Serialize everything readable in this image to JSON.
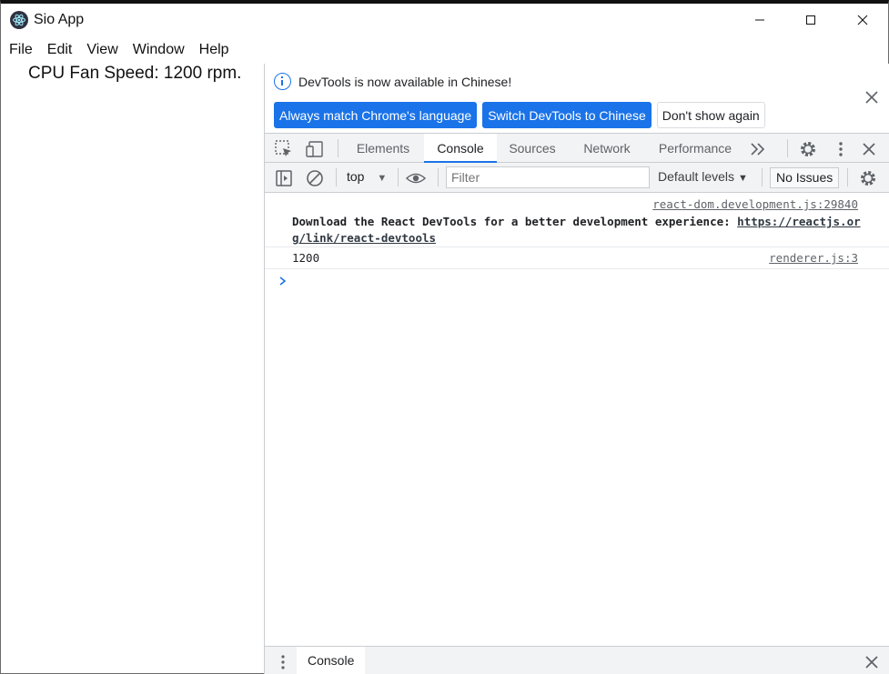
{
  "window": {
    "title": "Sio App",
    "minimize_icon": "minimize-icon",
    "maximize_icon": "maximize-icon",
    "close_icon": "close-icon"
  },
  "menu": [
    "File",
    "Edit",
    "View",
    "Window",
    "Help"
  ],
  "app": {
    "fan_speed_text": "CPU Fan Speed: 1200 rpm."
  },
  "devtools": {
    "infobar": {
      "message": "DevTools is now available in Chinese!",
      "buttons": {
        "always_match": "Always match Chrome's language",
        "switch": "Switch DevTools to Chinese",
        "dont_show": "Don't show again"
      }
    },
    "tabs": [
      "Elements",
      "Console",
      "Sources",
      "Network",
      "Performance"
    ],
    "active_tab": "Console",
    "filterbar": {
      "context": "top",
      "filter_placeholder": "Filter",
      "levels": "Default levels",
      "issues": "No Issues"
    },
    "console": {
      "messages": [
        {
          "source": "react-dom.development.js:29840",
          "text": "Download the React DevTools for a better development experience: ",
          "link": "https://reactjs.org/link/react-devtools"
        },
        {
          "source": "renderer.js:3",
          "text": "1200"
        }
      ]
    },
    "drawer": {
      "tab": "Console"
    }
  },
  "colors": {
    "accent": "#1a73e8",
    "toolbar_bg": "#f1f3f4",
    "border": "#cacdd1"
  }
}
